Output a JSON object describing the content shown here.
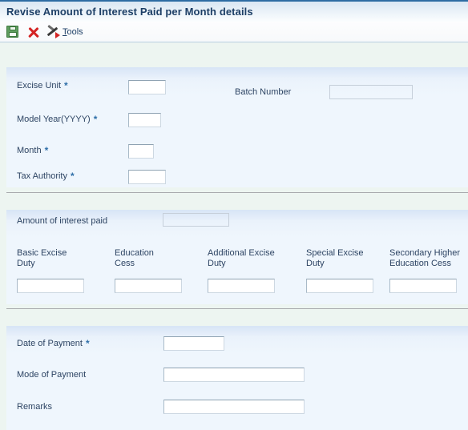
{
  "window": {
    "title": "Revise Amount of Interest Paid per Month details"
  },
  "toolbar": {
    "save_icon": "save-floppy-icon",
    "cancel_icon": "cancel-x-icon",
    "tools_icon": "tools-hammer-icon",
    "tools_label_underlined": "T",
    "tools_label_rest": "ools"
  },
  "section_main": {
    "fields": [
      {
        "label": "Excise Unit",
        "required": true,
        "value": "",
        "disabled": false
      },
      {
        "label": "Model Year(YYYY)",
        "required": true,
        "value": "",
        "disabled": false
      },
      {
        "label": "Month",
        "required": true,
        "value": "",
        "disabled": false
      },
      {
        "label": "Tax Authority",
        "required": true,
        "value": "",
        "disabled": false
      },
      {
        "label": "Batch Number",
        "required": false,
        "value": "",
        "disabled": true
      }
    ]
  },
  "section_interest": {
    "header_label": "Amount of interest paid",
    "header_value": "",
    "columns": [
      {
        "label": "Basic Excise\nDuty",
        "value": ""
      },
      {
        "label": "Education\nCess",
        "value": ""
      },
      {
        "label": "Additional Excise\nDuty",
        "value": ""
      },
      {
        "label": "Special Excise\nDuty",
        "value": ""
      },
      {
        "label": "Secondary Higher\nEducation Cess",
        "value": ""
      }
    ]
  },
  "section_payment": {
    "fields": [
      {
        "label": "Date of Payment",
        "required": true,
        "value": ""
      },
      {
        "label": "Mode of Payment",
        "required": false,
        "value": ""
      },
      {
        "label": "Remarks",
        "required": false,
        "value": ""
      }
    ]
  },
  "colors": {
    "title_text": "#1d3f66",
    "panel_bg": "#eff6fd",
    "page_bg": "#edf5f1",
    "accent_border": "#2d6ca3",
    "required_star": "#2f6fa8"
  }
}
